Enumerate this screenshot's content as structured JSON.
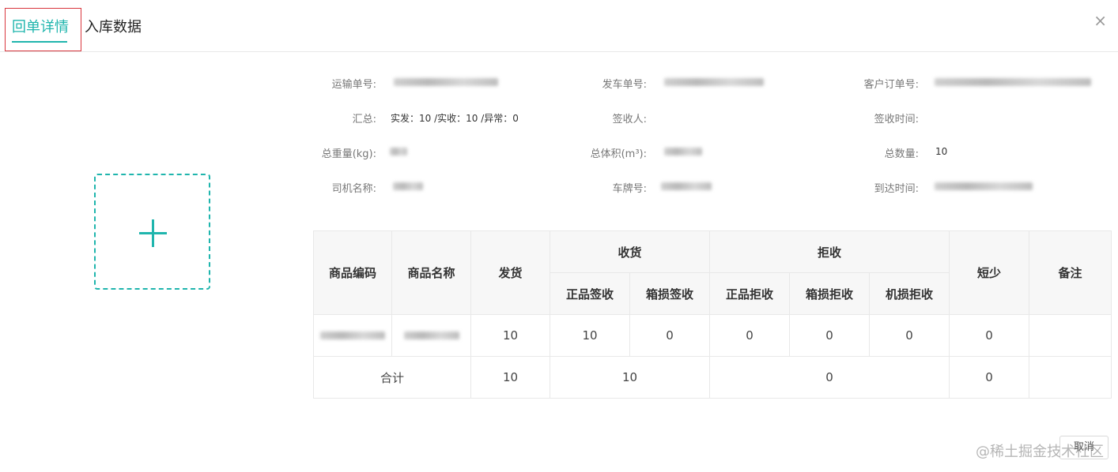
{
  "tabs": [
    {
      "label": "回单详情"
    },
    {
      "label": "入库数据"
    }
  ],
  "close_icon": "×",
  "accent_color": "#1fb5ad",
  "info": {
    "transport_no_label": "运输单号:",
    "dispatch_no_label": "发车单号:",
    "customer_order_label": "客户订单号:",
    "summary_label": "汇总:",
    "summary_value": "实发：10 /实收：10 /异常：0",
    "receiver_label": "签收人:",
    "receive_time_label": "签收时间:",
    "weight_label": "总重量(kg):",
    "volume_label": "总体积(m³):",
    "quantity_label": "总数量:",
    "quantity_value": "10",
    "driver_label": "司机名称:",
    "plate_label": "车牌号:",
    "arrival_label": "到达时间:"
  },
  "table": {
    "headers": {
      "code": "商品编码",
      "name": "商品名称",
      "shipped": "发货",
      "received": "收货",
      "received_good": "正品签收",
      "received_box_damage": "箱损签收",
      "rejected": "拒收",
      "rejected_good": "正品拒收",
      "rejected_box_damage": "箱损拒收",
      "rejected_machine_damage": "机损拒收",
      "short": "短少",
      "remark": "备注"
    },
    "row": {
      "shipped": "10",
      "received_good": "10",
      "received_box_damage": "0",
      "rejected_good": "0",
      "rejected_box_damage": "0",
      "rejected_machine_damage": "0",
      "short": "0"
    },
    "total": {
      "label": "合计",
      "shipped": "10",
      "received": "10",
      "rejected": "0",
      "short": "0"
    }
  },
  "footer": {
    "cancel_label": "取消",
    "watermark": "@稀土掘金技术社区"
  }
}
